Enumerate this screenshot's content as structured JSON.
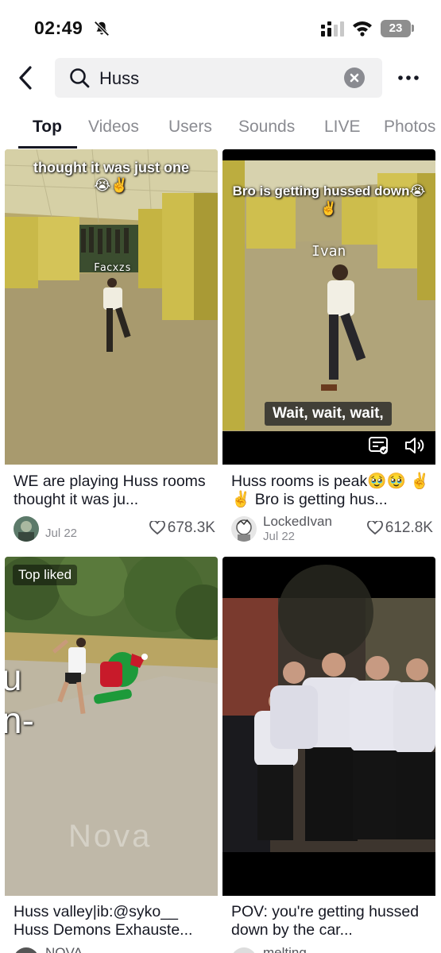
{
  "status_bar": {
    "time": "02:49",
    "battery": "23",
    "icons": [
      "bell-slash-icon",
      "signal-icon",
      "wifi-icon",
      "battery-icon"
    ]
  },
  "header": {
    "search_value": "Huss",
    "icons": [
      "back-chevron-icon",
      "search-icon",
      "clear-icon",
      "more-icon"
    ]
  },
  "tabs": [
    {
      "label": "Top",
      "active": true
    },
    {
      "label": "Videos",
      "active": false
    },
    {
      "label": "Users",
      "active": false
    },
    {
      "label": "Sounds",
      "active": false
    },
    {
      "label": "LIVE",
      "active": false
    },
    {
      "label": "Photos",
      "active": false
    }
  ],
  "results": [
    {
      "overlay_text": "thought it was just one\n😭✌️",
      "name_tag": "Facxzs",
      "caption": "WE are playing Huss rooms thought it was ju...",
      "author": "",
      "date": "Jul 22",
      "likes": "678.3K"
    },
    {
      "overlay_text": "Bro is getting hussed down😭\n✌️",
      "name_tag": "Ivan",
      "subtitle": "Wait, wait, wait,",
      "caption": "Huss rooms is peak🥹🥹 ✌️✌️ Bro is getting hus...",
      "author": "LockedIvan",
      "date": "Jul 22",
      "likes": "612.8K"
    },
    {
      "badge": "Top liked",
      "side_text": "u\nn-",
      "watermark": "Nova",
      "caption": "Huss valley|ib:@syko__ Huss Demons Exhauste...",
      "author": "NOVA"
    },
    {
      "caption": "POV: you're getting hussed down by the car...",
      "author": "melting"
    }
  ],
  "colors": {
    "text_primary": "#161823",
    "text_secondary": "#8a8b91",
    "search_bg": "#f1f1f2",
    "backrooms_yellow": "#c9b949",
    "floor": "#a89a6e"
  }
}
